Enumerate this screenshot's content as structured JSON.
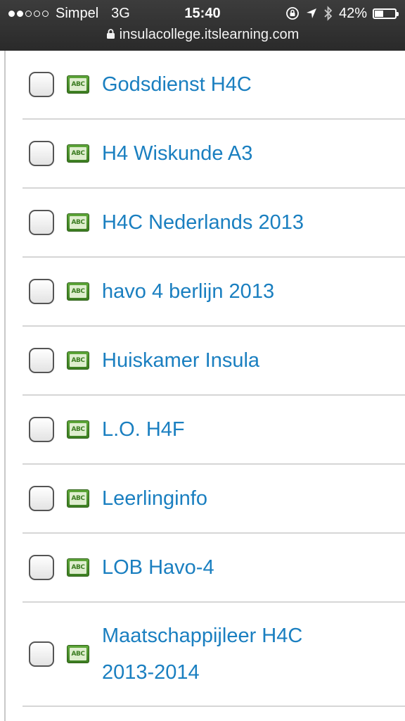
{
  "status_bar": {
    "carrier": "Simpel",
    "network": "3G",
    "time": "15:40",
    "battery_text": "42%",
    "battery_level": 0.42,
    "signal_strength": 2,
    "signal_max": 5,
    "url": "insulacollege.itslearning.com",
    "icons": [
      "rotation-lock-icon",
      "location-arrow-icon",
      "bluetooth-icon",
      "battery-icon",
      "lock-icon"
    ]
  },
  "courses": [
    {
      "title": "Godsdienst H4C",
      "icon_text": "ABC"
    },
    {
      "title": "H4 Wiskunde A3",
      "icon_text": "ABC"
    },
    {
      "title": "H4C Nederlands 2013",
      "icon_text": "ABC"
    },
    {
      "title": "havo 4 berlijn 2013",
      "icon_text": "ABC"
    },
    {
      "title": "Huiskamer Insula",
      "icon_text": "ABC"
    },
    {
      "title": "L.O. H4F",
      "icon_text": "ABC"
    },
    {
      "title": "Leerlinginfo",
      "icon_text": "ABC"
    },
    {
      "title": "LOB Havo-4",
      "icon_text": "ABC"
    },
    {
      "title": "Maatschappijleer H4C 2013-2014",
      "icon_text": "ABC"
    }
  ],
  "colors": {
    "link": "#1a7fc0",
    "course_icon_green": "#4a9a2c",
    "divider": "#d6d6d6",
    "status_bar_bg": "#333333"
  }
}
